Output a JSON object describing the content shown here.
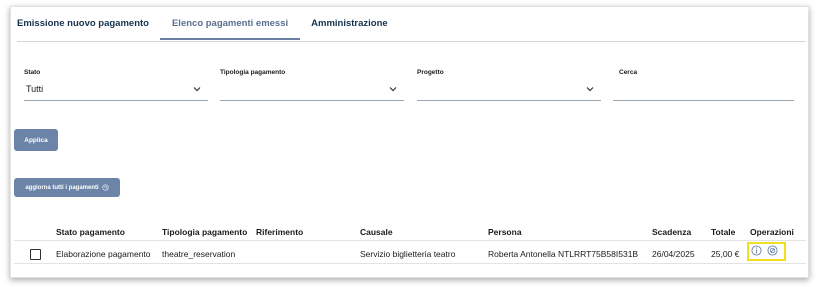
{
  "tabs": [
    {
      "label": "Emissione nuovo pagamento"
    },
    {
      "label": "Elenco pagamenti emessi"
    },
    {
      "label": "Amministrazione"
    }
  ],
  "filters": {
    "stato": {
      "label": "Stato",
      "value": "Tutti"
    },
    "tipologia": {
      "label": "Tipologia pagamento",
      "value": ""
    },
    "progetto": {
      "label": "Progetto",
      "value": ""
    },
    "cerca": {
      "label": "Cerca",
      "value": ""
    }
  },
  "buttons": {
    "apply": "Applica",
    "refresh": "aggiorna tutti i pagamenti"
  },
  "table": {
    "headers": [
      "Stato pagamento",
      "Tipologia pagamento",
      "Riferimento",
      "Causale",
      "Persona",
      "Scadenza",
      "Totale",
      "Operazioni"
    ],
    "rows": [
      [
        "Elaborazione pagamento",
        "theatre_reservation",
        "",
        "Servizio biglietteria teatro",
        "Roberta Antonella NTLRRT75B58I531B",
        "26/04/2025",
        "25,00 €"
      ]
    ]
  },
  "colors": {
    "accent": "#6b84a8",
    "tab_text": "#17324d",
    "highlight": "#f0e020"
  },
  "icons": [
    "chevron-down-icon",
    "refresh-icon",
    "info-icon",
    "cancel-icon"
  ]
}
